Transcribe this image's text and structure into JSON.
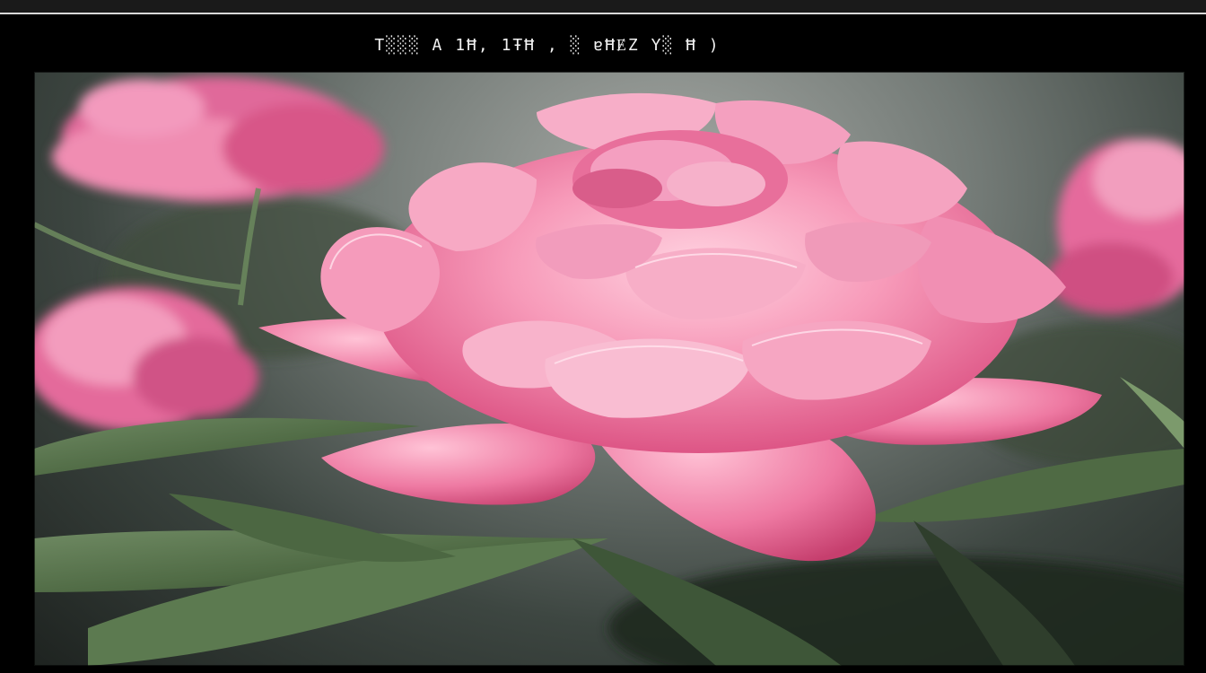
{
  "caption": "T░░░ A 1Ħ, 1ŦĦ , ░ ɐĦɆZ Y░ Ħ )",
  "scene": {
    "subject": "pink peony",
    "colors": {
      "petal_light": "#f8b6cd",
      "petal_mid": "#ef7fa6",
      "petal_deep": "#d94a7d",
      "leaf": "#4f6a44",
      "leaf_dark": "#2d3b2a",
      "background": "#5d6662"
    }
  }
}
